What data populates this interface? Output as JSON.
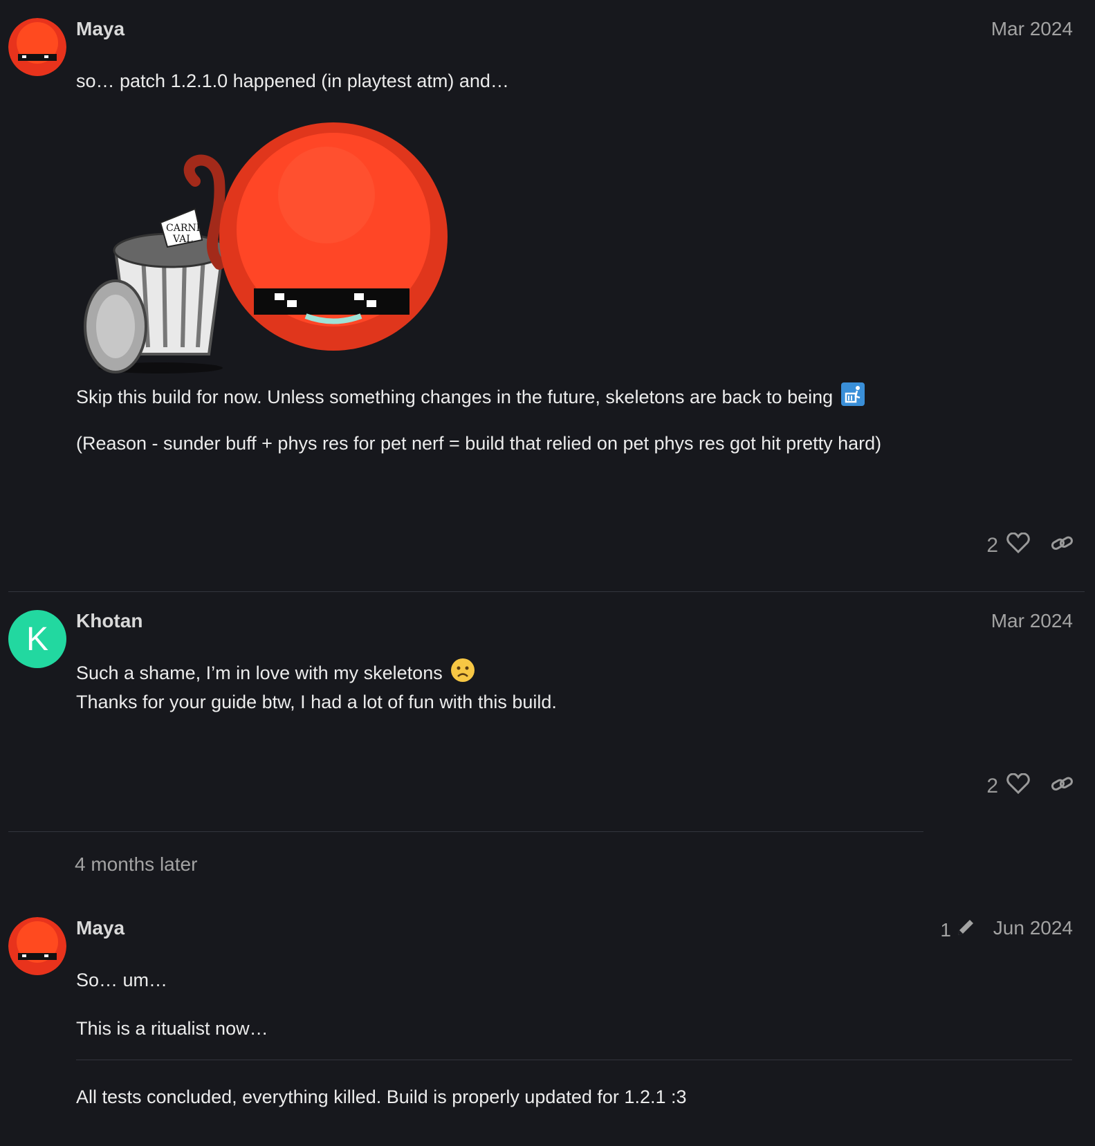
{
  "posts": [
    {
      "username": "Maya",
      "date": "Mar 2024",
      "lines": [
        "so… patch 1.2.1.0 happened (in playtest atm) and…",
        "Skip this build for now. Unless something changes in the future, skeletons are back to being",
        "(Reason - sunder buff + phys res for pet nerf = build that relied on pet phys res got hit pretty hard)"
      ],
      "image_text": "CARNI VAL",
      "likes": "2"
    },
    {
      "username": "Khotan",
      "avatar_letter": "K",
      "date": "Mar 2024",
      "lines": [
        "Such a shame, I’m in love with my skeletons",
        "Thanks for your guide btw, I had a lot of fun with this build."
      ],
      "likes": "2"
    },
    {
      "username": "Maya",
      "date": "Jun 2024",
      "edit_count": "1",
      "lines": [
        "So… um…",
        "This is a ritualist now…",
        "All tests concluded, everything killed. Build is properly updated for 1.2.1 :3"
      ]
    }
  ],
  "time_gap": "4 months later",
  "colors": {
    "bg": "#17181d",
    "text": "#ececec",
    "muted": "#a3a3a3",
    "khotan_avatar": "#22d8a0"
  },
  "icons": [
    "heart-icon",
    "link-icon",
    "pencil-icon",
    "wastebasket-emoji",
    "frowning-face-emoji"
  ]
}
